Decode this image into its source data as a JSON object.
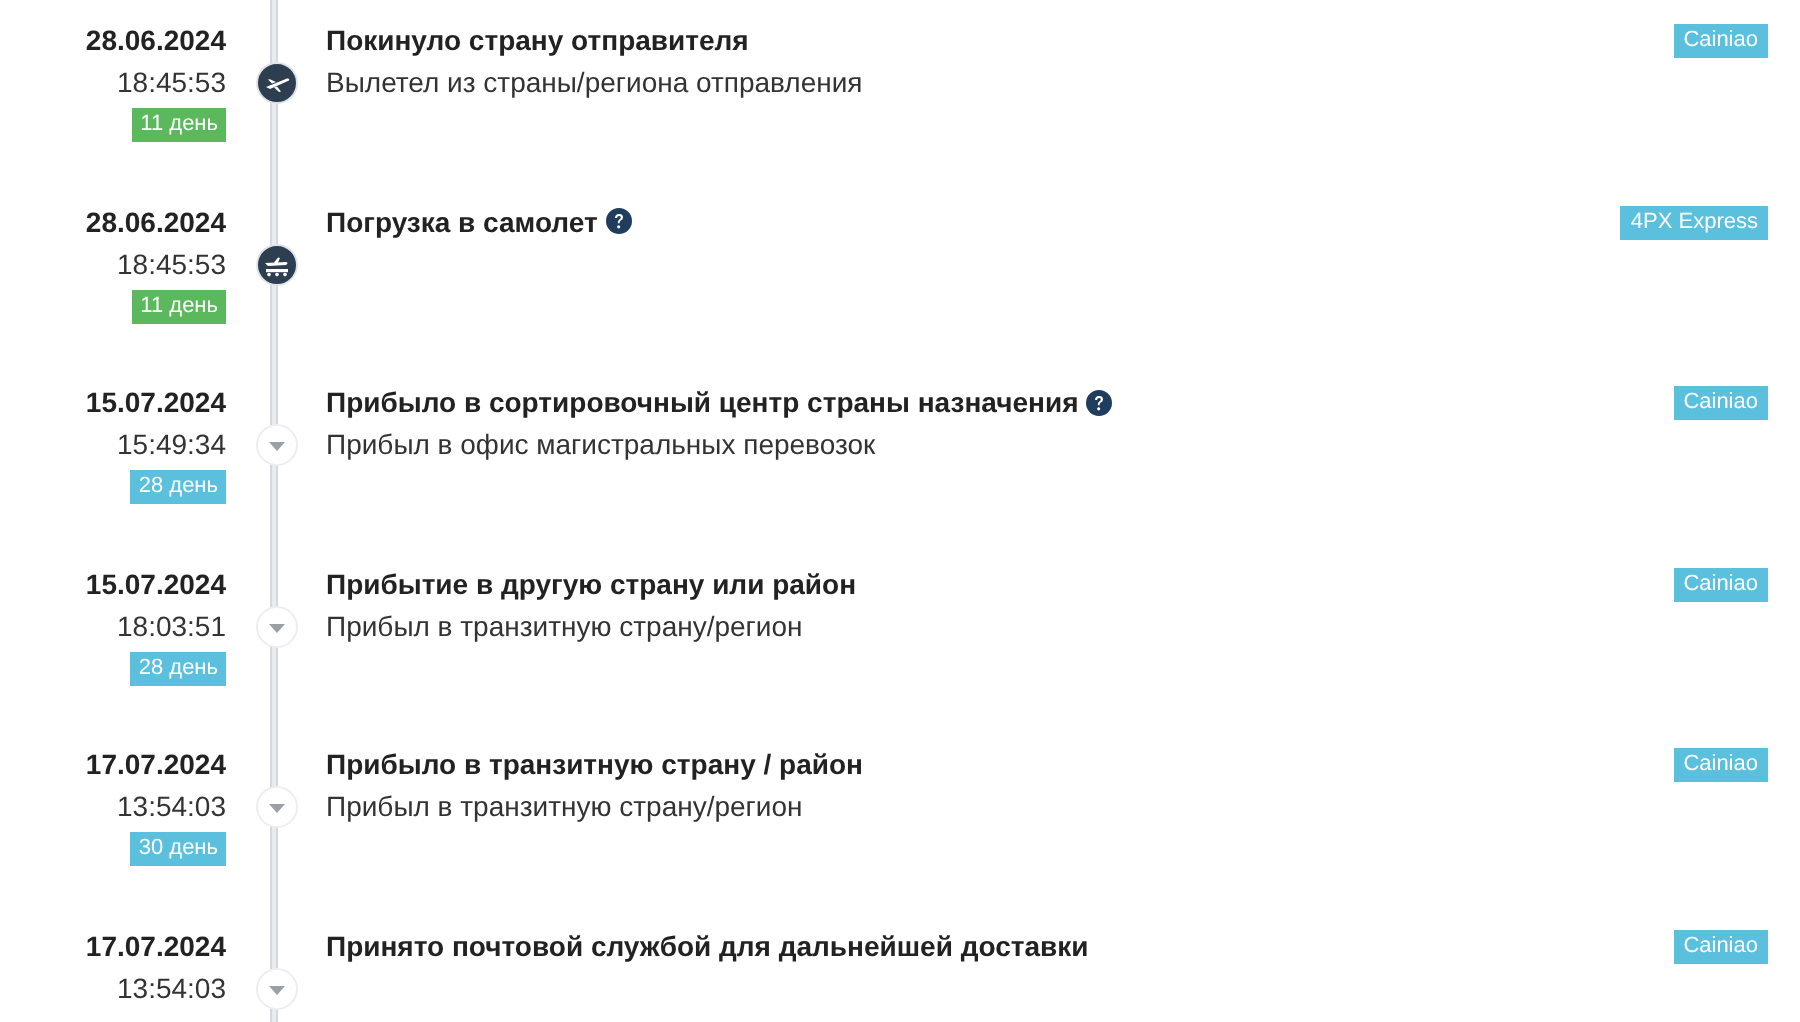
{
  "events": [
    {
      "date": "28.06.2024",
      "time": "18:45:53",
      "days": "11 день",
      "color": "#5cb85c",
      "kind": "plane",
      "title": "Покинуло страну отправителя",
      "help": false,
      "detail": "Вылетел из страны/региона отправления",
      "carrier": "Cainiao"
    },
    {
      "date": "28.06.2024",
      "time": "18:45:53",
      "days": "11 день",
      "color": "#5cb85c",
      "kind": "loading",
      "title": "Погрузка в самолет",
      "help": true,
      "carrier": "4PX Express"
    },
    {
      "date": "15.07.2024",
      "time": "15:49:34",
      "days": "28 день",
      "color": "#5bc0de",
      "kind": "arrow",
      "title": "Прибыло в сортировочный центр страны назначения",
      "help": true,
      "detail": "Прибыл в офис магистральных перевозок",
      "carrier": "Cainiao"
    },
    {
      "date": "15.07.2024",
      "time": "18:03:51",
      "days": "28 день",
      "color": "#5bc0de",
      "kind": "arrow",
      "title": "Прибытие в другую страну или район",
      "help": false,
      "detail": "Прибыл в транзитную страну/регион",
      "carrier": "Cainiao"
    },
    {
      "date": "17.07.2024",
      "time": "13:54:03",
      "days": "30 день",
      "color": "#5bc0de",
      "kind": "arrow",
      "title": "Прибыло в транзитную страну / район",
      "help": false,
      "detail": "Прибыл в транзитную страну/регион",
      "carrier": "Cainiao"
    },
    {
      "date": "17.07.2024",
      "time": "13:54:03",
      "kind": "arrow",
      "title": "Принято почтовой службой для дальнейшей доставки",
      "help": false,
      "carrier": "Cainiao"
    }
  ]
}
